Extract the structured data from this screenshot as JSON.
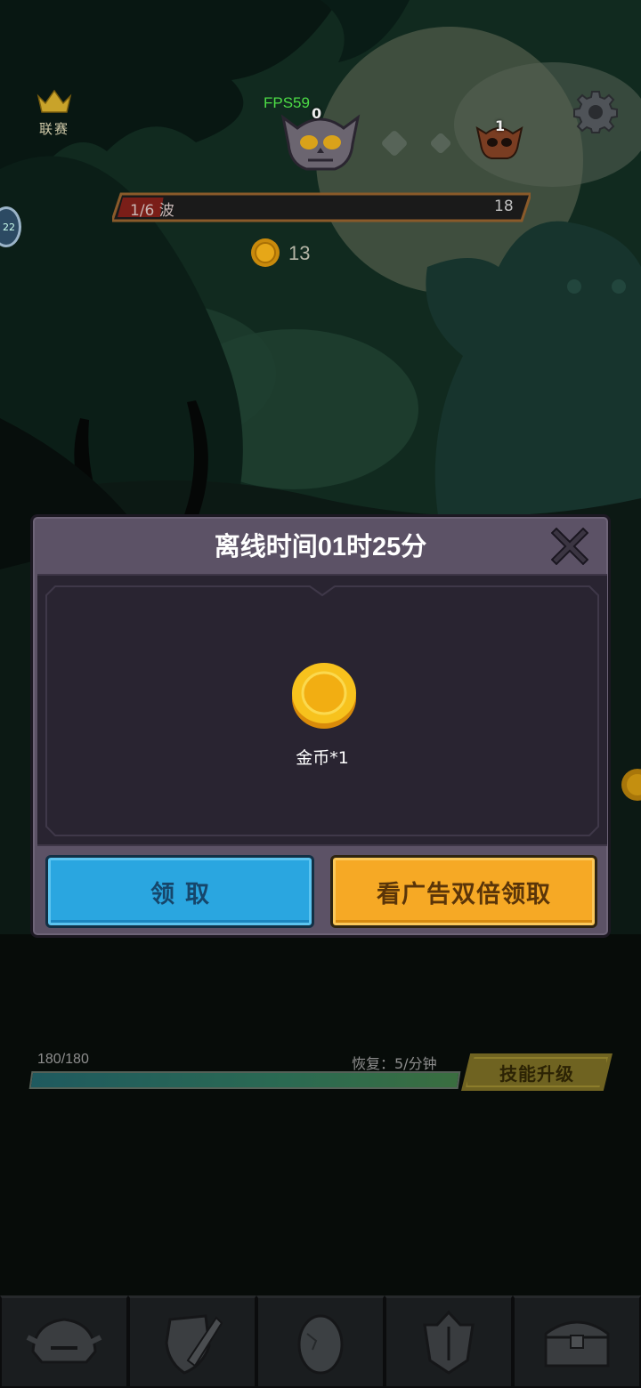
{
  "hud": {
    "league_label": "联赛",
    "fps": "FPS59",
    "boss_count": "0",
    "mini_boss_count": "1",
    "side_badge": "22",
    "wave_label": "1/6 波",
    "wave_total": "18",
    "wave_progress": 0.1,
    "coins": "13"
  },
  "modal": {
    "title": "离线时间01时25分",
    "reward_label": "金币*1",
    "claim_label": "领取",
    "double_label": "看广告双倍领取"
  },
  "bottom": {
    "hp_text": "180/180",
    "hp_fraction": 1.0,
    "regen_text": "恢复：5/分钟",
    "skill_upgrade_label": "技能升级"
  },
  "tabs": [
    {
      "icon": "helmet-icon"
    },
    {
      "icon": "shield-sword-icon"
    },
    {
      "icon": "egg-icon"
    },
    {
      "icon": "armor-icon"
    },
    {
      "icon": "treasure-chest-icon"
    }
  ],
  "colors": {
    "claim_button": "#2aa6e0",
    "double_button": "#f6a925",
    "fps": "#4ddc46",
    "modal_frame": "#5c5266"
  }
}
